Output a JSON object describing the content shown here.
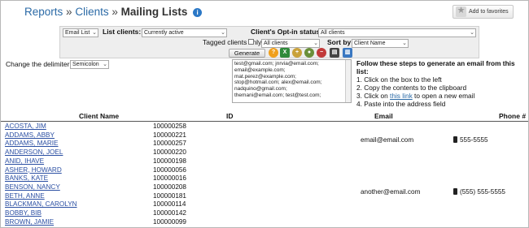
{
  "header": {
    "breadcrumb_reports": "Reports",
    "breadcrumb_sep1": "»",
    "breadcrumb_clients": "Clients",
    "breadcrumb_sep2": "»",
    "page_title": "Mailing Lists",
    "info_icon": "i",
    "favorites_button": "Add to favorites"
  },
  "filters": {
    "list_type": "Email List",
    "list_clients_label": "List clients:",
    "list_clients_value": "Currently active",
    "optin_label": "Client's Opt-in status",
    "optin_value": "All clients",
    "tagged_label": "Tagged clients only (0):",
    "tagged_select": "All clients",
    "sort_by_label": "Sort by",
    "sort_by_value": "Client Name",
    "generate_button": "Generate",
    "delimiter_label": "Change the delimiter:",
    "delimiter_value": "Semicolon"
  },
  "toolbar_icons": [
    "help-icon",
    "excel-icon",
    "add-user-icon",
    "user-group-icon",
    "remove-user-icon",
    "print-icon",
    "printer-label-icon"
  ],
  "email_box": {
    "lines": [
      "test@gmail.com; jnrvia@email.com;",
      "email@example.com;",
      "mat.perez@example.com;",
      "stop@hotmail.com; alex@email.com;",
      "nadquino@gmail.com;",
      "themani@email.com; test@test.com;"
    ]
  },
  "steps": {
    "heading": "Follow these steps to generate an email from this list:",
    "step1": "1. Click on the box to the left",
    "step2": "2. Copy the contents to the clipboard",
    "step3_pre": "3. Click on ",
    "step3_link": "this link",
    "step3_post": " to open a new email",
    "step4": "4. Paste into the address field"
  },
  "table": {
    "columns": {
      "name": "Client Name",
      "id": "ID",
      "email": "Email",
      "phone": "Phone #"
    },
    "rows": [
      {
        "name": "ACOSTA, JIM",
        "id": "100000258",
        "email": "",
        "phone": ""
      },
      {
        "name": "ADDAMS, ABBY",
        "id": "100000221",
        "email": "",
        "phone": ""
      },
      {
        "name": "ADDAMS, MARIE",
        "id": "100000257",
        "email": "email@email.com",
        "phone": "555-5555"
      },
      {
        "name": "ANDERSON, JOEL",
        "id": "100000220",
        "email": "",
        "phone": ""
      },
      {
        "name": "ANID, IHAVE",
        "id": "100000198",
        "email": "",
        "phone": ""
      },
      {
        "name": "ASHER, HOWARD",
        "id": "100000056",
        "email": "",
        "phone": ""
      },
      {
        "name": "BANKS, KATE",
        "id": "100000016",
        "email": "",
        "phone": ""
      },
      {
        "name": "BENSON, NANCY",
        "id": "100000208",
        "email": "",
        "phone": ""
      },
      {
        "name": "BETH, ANNE",
        "id": "100000181",
        "email": "another@email.com",
        "phone": "(555) 555-5555"
      },
      {
        "name": "BLACKMAN, CAROLYN",
        "id": "100000114",
        "email": "",
        "phone": ""
      },
      {
        "name": "BOBBY, BIB",
        "id": "100000142",
        "email": "",
        "phone": ""
      },
      {
        "name": "BROWN, JAMIE",
        "id": "100000099",
        "email": "",
        "phone": ""
      }
    ]
  }
}
